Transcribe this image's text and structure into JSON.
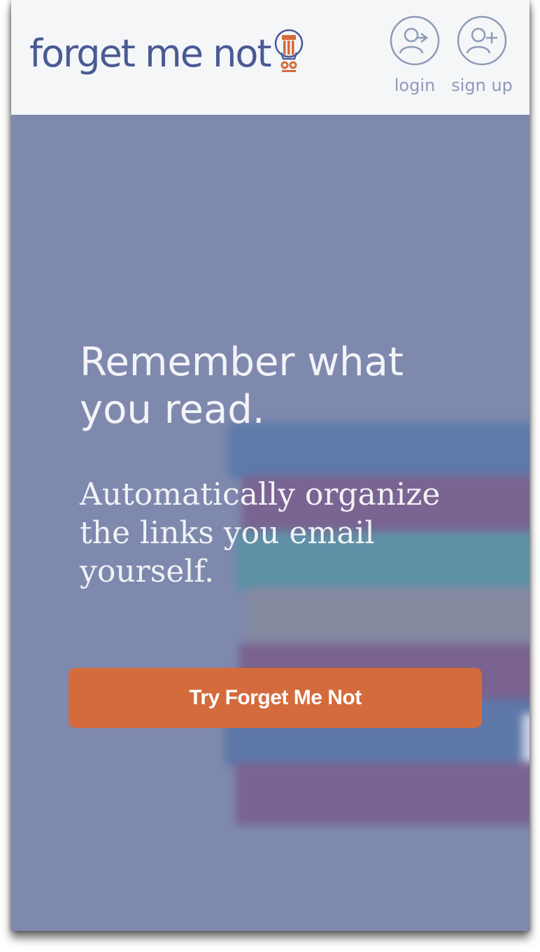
{
  "header": {
    "logo_text": "forget me not",
    "login_label": "login",
    "signup_label": "sign up",
    "icons": [
      "lightbulb-logo-icon",
      "user-login-icon",
      "user-add-icon"
    ]
  },
  "hero": {
    "headline": "Remember what you read.",
    "subheadline": "Automatically organize the links you email yourself.",
    "cta_label": "Try Forget Me Not"
  },
  "colors": {
    "header_bg": "#f4f6f8",
    "brand_text": "#4a5a94",
    "accent_orange": "#d46b3c",
    "hero_overlay": "#7f89ae",
    "nav_icon": "#8e9ab8"
  }
}
